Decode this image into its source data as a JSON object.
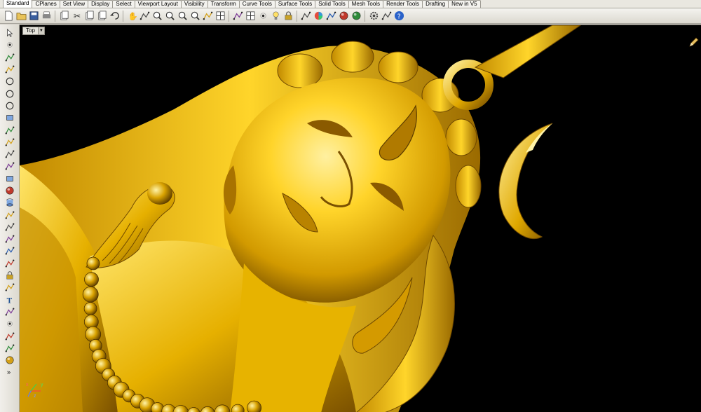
{
  "tabs": [
    {
      "label": "Standard",
      "active": true
    },
    {
      "label": "CPlanes"
    },
    {
      "label": "Set View"
    },
    {
      "label": "Display"
    },
    {
      "label": "Select"
    },
    {
      "label": "Viewport Layout"
    },
    {
      "label": "Visibility"
    },
    {
      "label": "Transform"
    },
    {
      "label": "Curve Tools"
    },
    {
      "label": "Surface Tools"
    },
    {
      "label": "Solid Tools"
    },
    {
      "label": "Mesh Tools"
    },
    {
      "label": "Render Tools"
    },
    {
      "label": "Drafting"
    },
    {
      "label": "New in V5"
    }
  ],
  "toolbar": {
    "icons": [
      "new-file-icon",
      "open-folder-icon",
      "save-icon",
      "print-icon",
      "import-icon",
      "cut-icon",
      "copy-icon",
      "paste-icon",
      "undo-icon",
      "pan-hand-icon",
      "move-view-icon",
      "zoom-window-icon",
      "zoom-dynamic-icon",
      "zoom-extents-icon",
      "zoom-selected-icon",
      "rotate-view-icon",
      "four-viewports-icon",
      "cplane-icon",
      "grid-icon",
      "select-points-icon",
      "light-bulb-icon",
      "lock-icon",
      "layer-icon",
      "color-wheel-icon",
      "shade-icon",
      "render-sphere-icon",
      "render-icon",
      "settings-gear-icon",
      "options-icon",
      "help-icon"
    ]
  },
  "left_tools": [
    "select-arrow-icon",
    "point-icon",
    "polyline-icon",
    "curve-icon",
    "circle-icon",
    "arc-icon",
    "ellipse-icon",
    "rectangle-icon",
    "polygon-icon",
    "fillet-curve-icon",
    "offset-icon",
    "extrude-icon",
    "box-solid-icon",
    "sphere-solid-icon",
    "cylinder-icon",
    "surface-icon",
    "boolean-icon",
    "mesh-icon",
    "transform-icon",
    "group-icon",
    "block-icon",
    "dimension-icon",
    "text-icon",
    "analyze-icon",
    "points-icon",
    "array-icon",
    "mirror-icon",
    "render-box-icon",
    "more-tools-icon"
  ],
  "viewport": {
    "label": "Top",
    "axes": {
      "x": "x",
      "y": "y",
      "z": "z"
    }
  },
  "colors": {
    "gold_light": "#ffd84a",
    "gold_mid": "#e0a800",
    "gold_dark": "#8a5a00",
    "background": "#000000"
  }
}
